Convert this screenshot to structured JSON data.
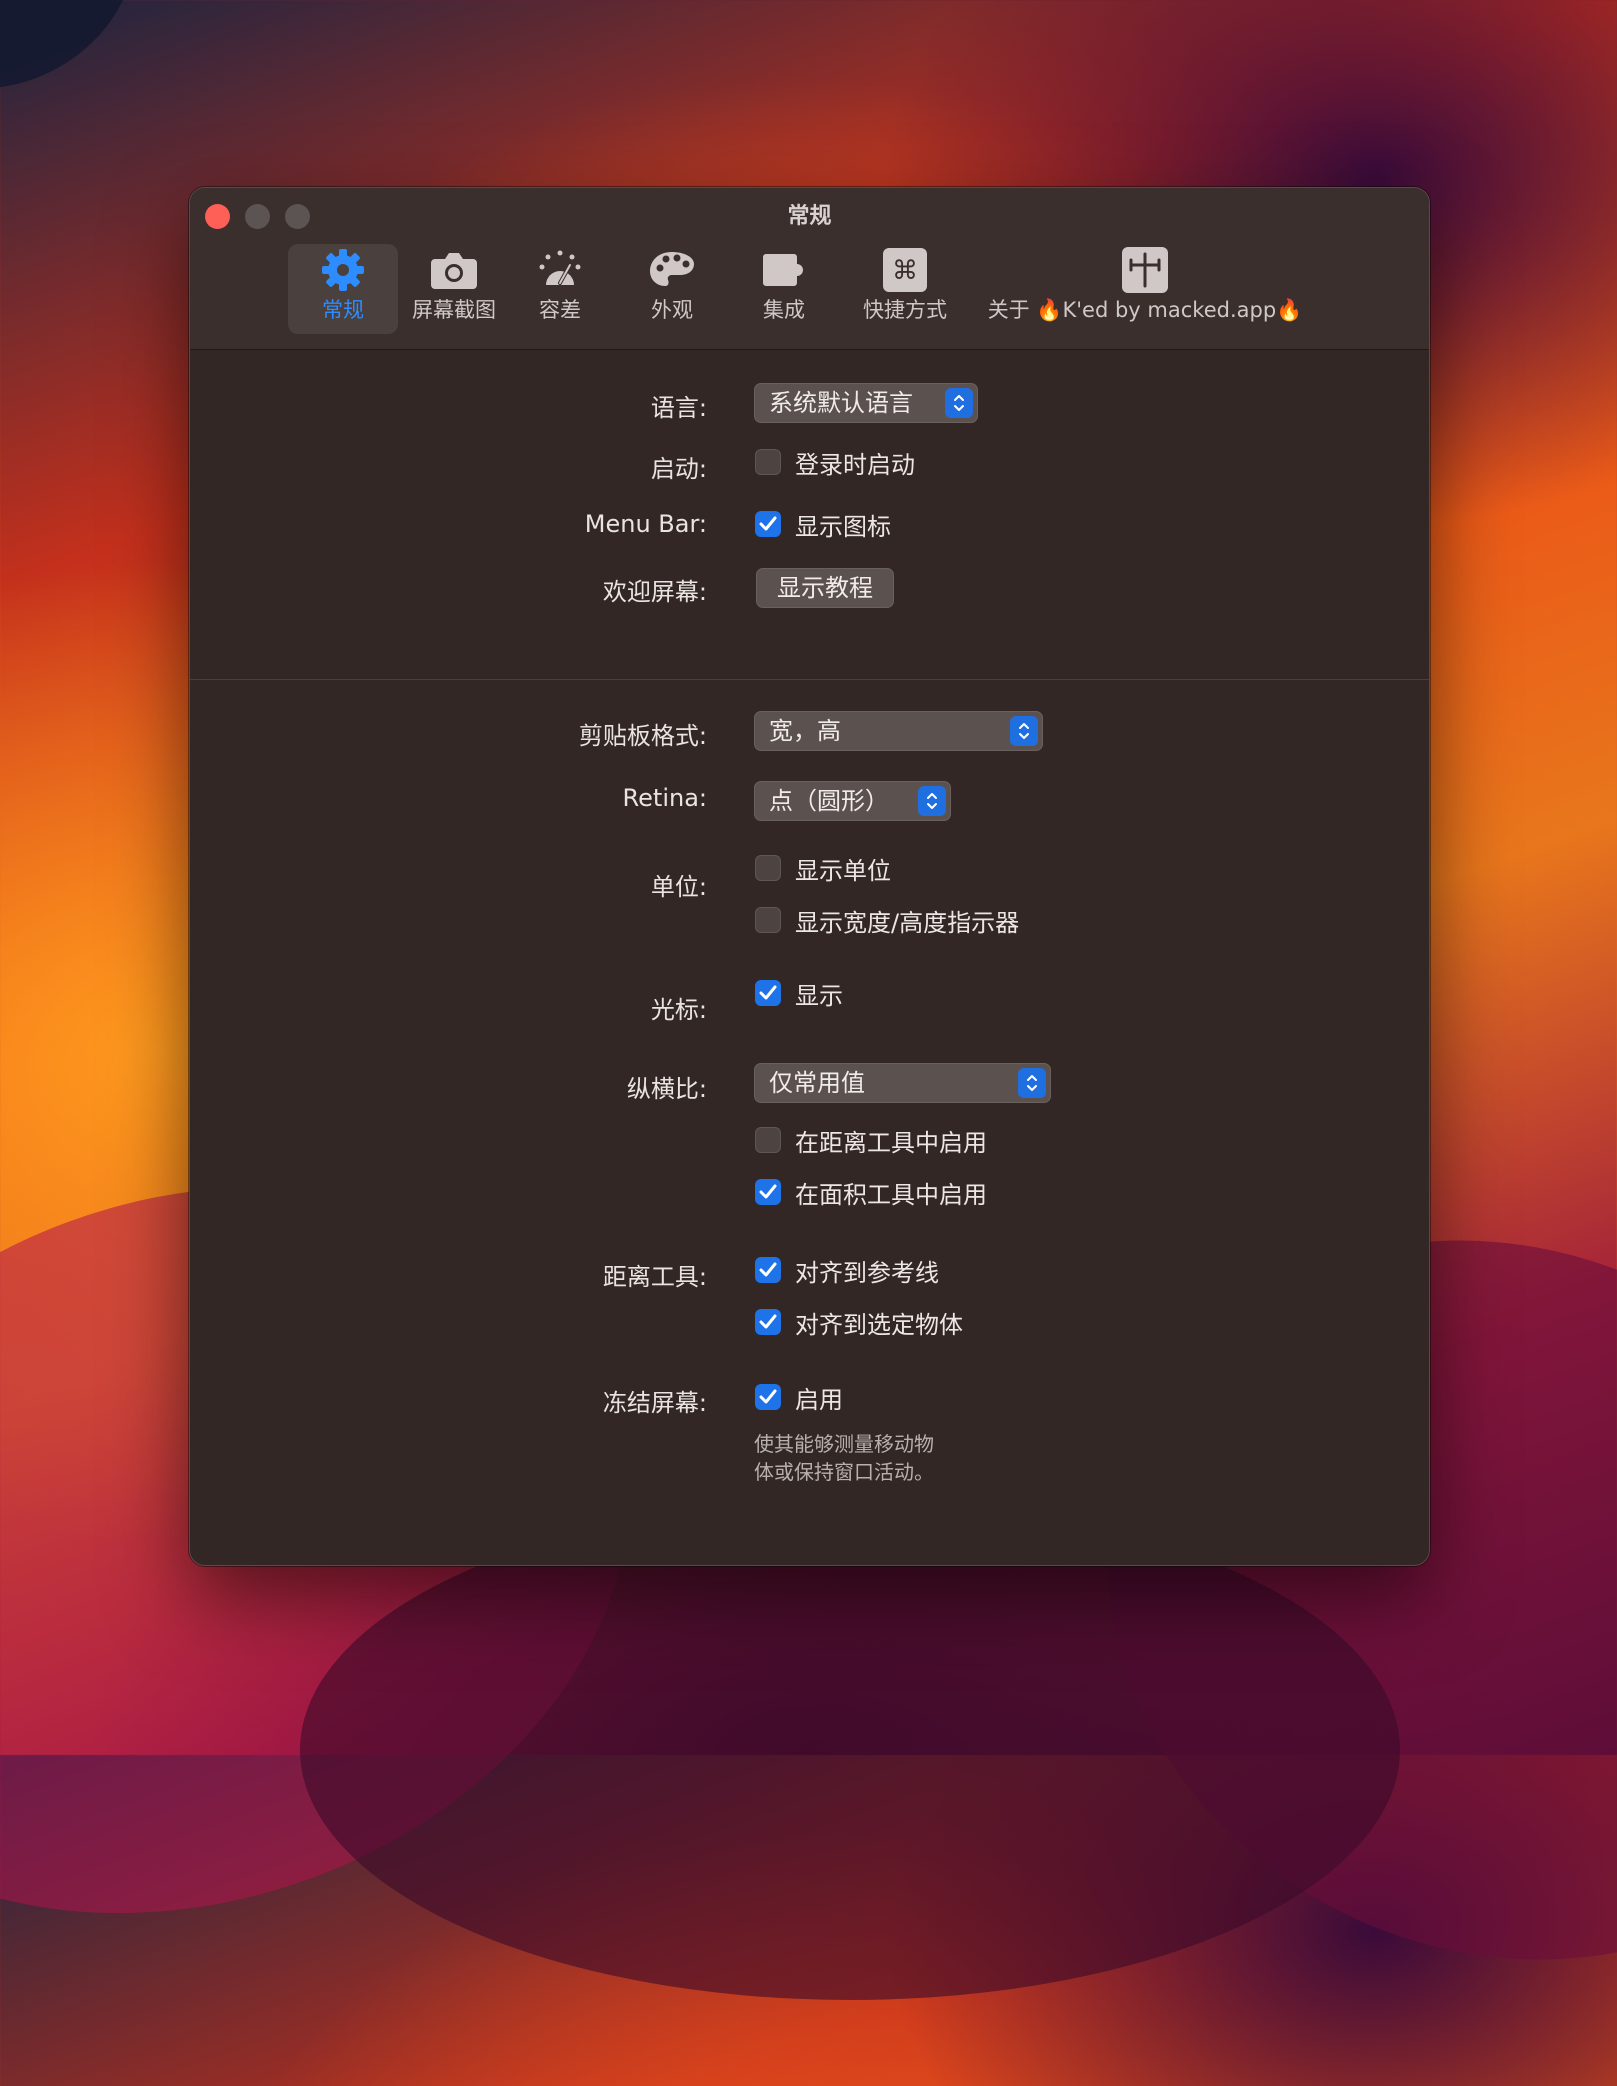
{
  "window": {
    "title": "常规"
  },
  "toolbar": {
    "items": [
      {
        "label": "常规",
        "icon": "gear-icon",
        "active": true
      },
      {
        "label": "屏幕截图",
        "icon": "camera-icon"
      },
      {
        "label": "容差",
        "icon": "tolerance-dial-icon"
      },
      {
        "label": "外观",
        "icon": "palette-icon"
      },
      {
        "label": "集成",
        "icon": "puzzle-icon"
      },
      {
        "label": "快捷方式",
        "icon": "command-key-icon"
      },
      {
        "label": "关于 🔥K'ed by macked.app🔥",
        "icon": "ruler-cursor-icon"
      }
    ]
  },
  "general": {
    "language_label": "语言:",
    "language_value": "系统默认语言",
    "startup_label": "启动:",
    "startup_option": "登录时启动",
    "startup_checked": false,
    "menubar_label": "Menu Bar:",
    "menubar_option": "显示图标",
    "menubar_checked": true,
    "welcome_label": "欢迎屏幕:",
    "welcome_button": "显示教程"
  },
  "measure": {
    "clipboard_label": "剪贴板格式:",
    "clipboard_value": "宽，高",
    "retina_label": "Retina:",
    "retina_value": "点（圆形）",
    "units_label": "单位:",
    "units_show": "显示单位",
    "units_show_checked": false,
    "units_indicator": "显示宽度/高度指示器",
    "units_indicator_checked": false,
    "cursor_label": "光标:",
    "cursor_show": "显示",
    "cursor_checked": true,
    "aspect_label": "纵横比:",
    "aspect_value": "仅常用值",
    "aspect_distance": "在距离工具中启用",
    "aspect_distance_checked": false,
    "aspect_area": "在面积工具中启用",
    "aspect_area_checked": true,
    "distance_label": "距离工具:",
    "snap_guides": "对齐到参考线",
    "snap_guides_checked": true,
    "snap_objects": "对齐到选定物体",
    "snap_objects_checked": true,
    "freeze_label": "冻结屏幕:",
    "freeze_enable": "启用",
    "freeze_checked": true,
    "freeze_note_line1": "使其能够测量移动物",
    "freeze_note_line2": "体或保持窗口活动。"
  },
  "colors": {
    "accent": "#1e73e8",
    "close": "#fe5f57",
    "window_bg": "#332725"
  }
}
